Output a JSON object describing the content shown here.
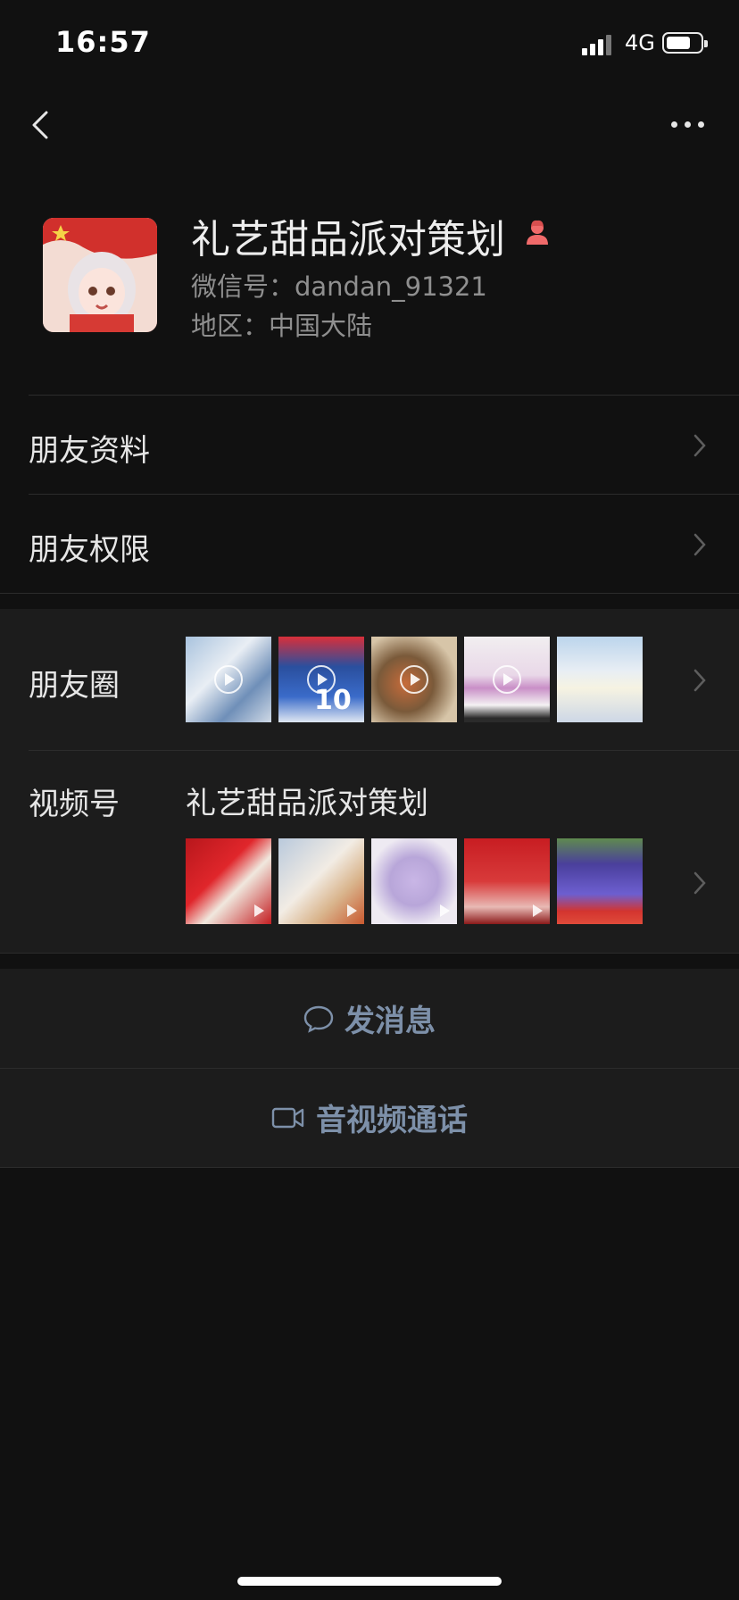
{
  "status_bar": {
    "time": "16:57",
    "network": "4G"
  },
  "profile": {
    "name": "礼艺甜品派对策划",
    "wechat_id": "微信号：dandan_91321",
    "region": "地区：中国大陆"
  },
  "menu": {
    "friend_info": "朋友资料",
    "friend_permissions": "朋友权限"
  },
  "moments": {
    "label": "朋友圈"
  },
  "channels": {
    "label": "视频号",
    "name": "礼艺甜品派对策划"
  },
  "actions": {
    "send_message": "发消息",
    "av_call": "音视频通话"
  },
  "icons": {
    "back": "back-arrow-icon",
    "more": "more-dots-icon",
    "gender": "female-icon",
    "chevron": "chevron-right-icon",
    "message": "chat-bubble-icon",
    "video": "video-camera-icon",
    "play": "play-icon"
  },
  "colors": {
    "background": "#111111",
    "card": "#1c1c1c",
    "link": "#7d90a9",
    "gender": "#f06a6a"
  }
}
